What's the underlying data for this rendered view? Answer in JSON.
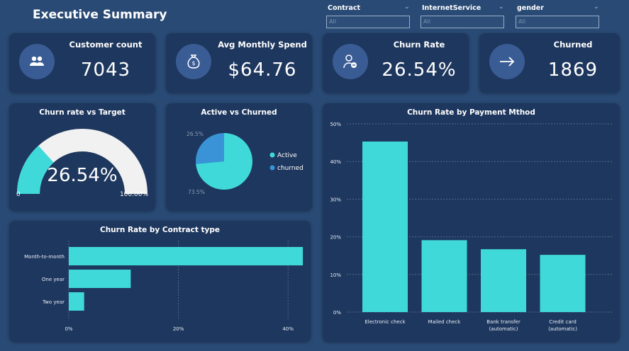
{
  "header": {
    "title": "Executive Summary"
  },
  "slicers": [
    {
      "label": "Contract",
      "value": "All"
    },
    {
      "label": "InternetService",
      "value": "All"
    },
    {
      "label": "gender",
      "value": "All"
    }
  ],
  "kpis": [
    {
      "label": "Customer count",
      "value": "7043",
      "icon": "people-icon"
    },
    {
      "label": "Avg Monthly Spend",
      "value": "$64.76",
      "icon": "money-bag-icon"
    },
    {
      "label": "Churn Rate",
      "value": "26.54%",
      "icon": "user-minus-icon"
    },
    {
      "label": "Churned",
      "value": "1869",
      "icon": "arrow-right-icon"
    }
  ],
  "gauge": {
    "title": "Churn rate vs Target",
    "value_label": "26.54%",
    "min_label": "0",
    "max_label": "100.00%",
    "value": 26.54,
    "min": 0,
    "max": 100,
    "fill_color": "#40d9da",
    "track_color": "#f1f1f1"
  },
  "pie": {
    "title": "Active vs Churned",
    "legend": [
      "Active",
      "churned"
    ],
    "labels": [
      "73.5%",
      "26.5%"
    ]
  },
  "contract_chart": {
    "title": "Churn Rate by Contract type"
  },
  "payment_chart": {
    "title": "Churn Rate by Payment Mthod"
  },
  "chart_data": [
    {
      "type": "pie",
      "title": "Active vs Churned",
      "categories": [
        "Active",
        "churned"
      ],
      "values": [
        73.5,
        26.5
      ],
      "colors": [
        "#40d9da",
        "#3a93d6"
      ],
      "legend": "right"
    },
    {
      "type": "bar",
      "orientation": "horizontal",
      "title": "Churn Rate by Contract type",
      "categories": [
        "Month-to-month",
        "One year",
        "Two year"
      ],
      "values": [
        42.7,
        11.3,
        2.8
      ],
      "xticks": [
        "0%",
        "20%",
        "40%"
      ],
      "xlim": [
        0,
        45
      ],
      "grid": true,
      "color": "#40d9da"
    },
    {
      "type": "bar",
      "title": "Churn Rate by Payment Mthod",
      "categories": [
        "Electronic check",
        "Mailed check",
        "Bank transfer (automatic)",
        "Credit card (automatic)"
      ],
      "values": [
        45.3,
        19.1,
        16.7,
        15.2
      ],
      "yticks": [
        "0%",
        "10%",
        "20%",
        "30%",
        "40%",
        "50%"
      ],
      "ylim": [
        0,
        50
      ],
      "grid": true,
      "color": "#40d9da"
    }
  ]
}
